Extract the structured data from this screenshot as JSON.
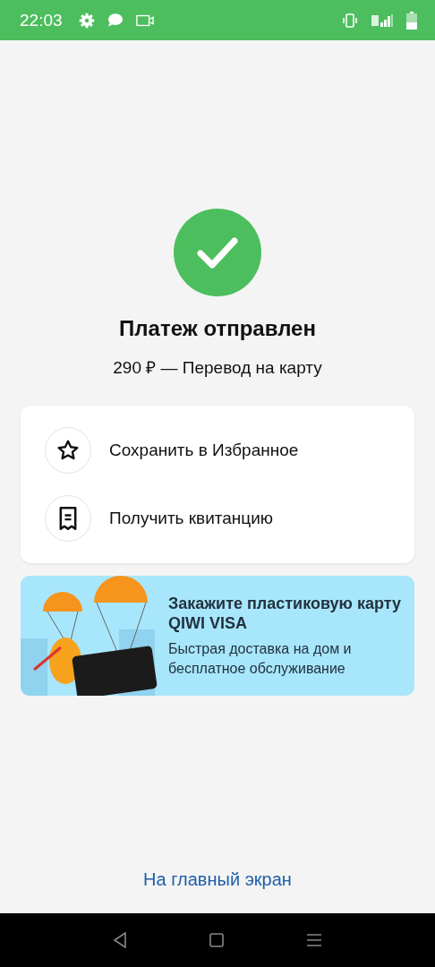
{
  "status_bar": {
    "time": "22:03"
  },
  "result": {
    "title": "Платеж отправлен",
    "subtitle": "290 ₽ — Перевод на карту"
  },
  "actions": [
    {
      "kind": "favorite",
      "label": "Сохранить в Избранное"
    },
    {
      "kind": "receipt",
      "label": "Получить квитанцию"
    }
  ],
  "banner": {
    "title": "Закажите пластиковую карту QIWI VISA",
    "text": "Быстрая доставка на дом и бесплатное обслуживание"
  },
  "home_link": "На главный экран"
}
